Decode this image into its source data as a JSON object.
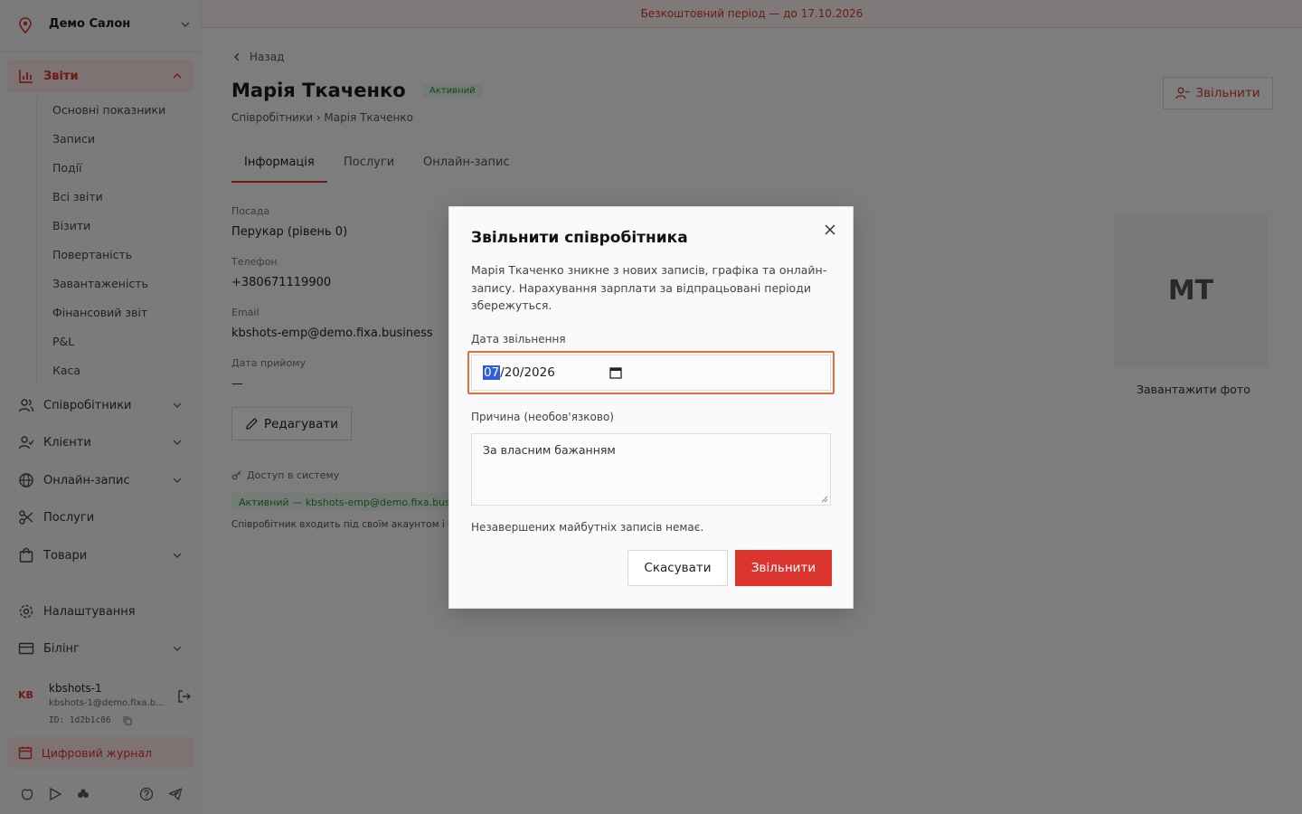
{
  "colors": {
    "accent": "#d9362b",
    "success": "#2c8a3e",
    "highlight": "#2f5ed6"
  },
  "sidebar": {
    "salon_name": "Демо Салон",
    "reports": {
      "label": "Звіти",
      "items": [
        "Основні показники",
        "Записи",
        "Події",
        "Всі звіти",
        "Візити",
        "Повертаність",
        "Завантаженість",
        "Фінансовий звіт",
        "P&L",
        "Каса"
      ]
    },
    "nav": [
      {
        "label": "Співробітники",
        "icon": "users-icon"
      },
      {
        "label": "Клієнти",
        "icon": "user-check-icon"
      },
      {
        "label": "Онлайн-запис",
        "icon": "globe-icon"
      },
      {
        "label": "Послуги",
        "icon": "scissors-icon"
      },
      {
        "label": "Товари",
        "icon": "shopping-bag-icon"
      },
      {
        "label": "Налаштування",
        "icon": "gear-icon"
      },
      {
        "label": "Білінг",
        "icon": "credit-card-icon"
      }
    ],
    "user": {
      "initials": "KB",
      "name": "kbshots-1",
      "email": "kbshots-1@demo.fixa.b...",
      "id": "ID: 1d2b1c86"
    },
    "journal": "Цифровий журнал"
  },
  "topbar": {
    "trial": "Безкоштовний період — до 17.10.2026"
  },
  "page": {
    "back": "Назад",
    "title": "Марія Ткаченко",
    "status": "Активний",
    "breadcrumb": "Співробітники › Марія Ткаченко",
    "fire_button": "Звільнити",
    "tabs": [
      "Інформація",
      "Послуги",
      "Онлайн-запис"
    ],
    "fields": [
      {
        "label": "Посада",
        "value": "Перукар (рівень 0)"
      },
      {
        "label": "Телефон",
        "value": "+380671119900"
      },
      {
        "label": "Email",
        "value": "kbshots-emp@demo.fixa.business"
      },
      {
        "label": "Дата прийому",
        "value": "—"
      }
    ],
    "edit_button": "Редагувати",
    "access_label": "Доступ в систему",
    "access_status": "Активний — kbshots-emp@demo.fixa.business",
    "access_note": "Співробітник входить під своїм акаунтом і бачить свій розклад",
    "photo_initials": "MT",
    "upload_photo": "Завантажити фото"
  },
  "modal": {
    "title": "Звільнити співробітника",
    "description": "Марія Ткаченко зникне з нових записів, графіка та онлайн-запису. Нарахування зарплати за відпрацьовані періоди збережуться.",
    "date_label": "Дата звільнення",
    "date_month": "07",
    "date_rest": "/20/2026",
    "reason_label": "Причина (необов'язково)",
    "reason_value": "За власним бажанням",
    "note": "Незавершених майбутніх записів немає.",
    "cancel": "Скасувати",
    "confirm": "Звільнити"
  }
}
